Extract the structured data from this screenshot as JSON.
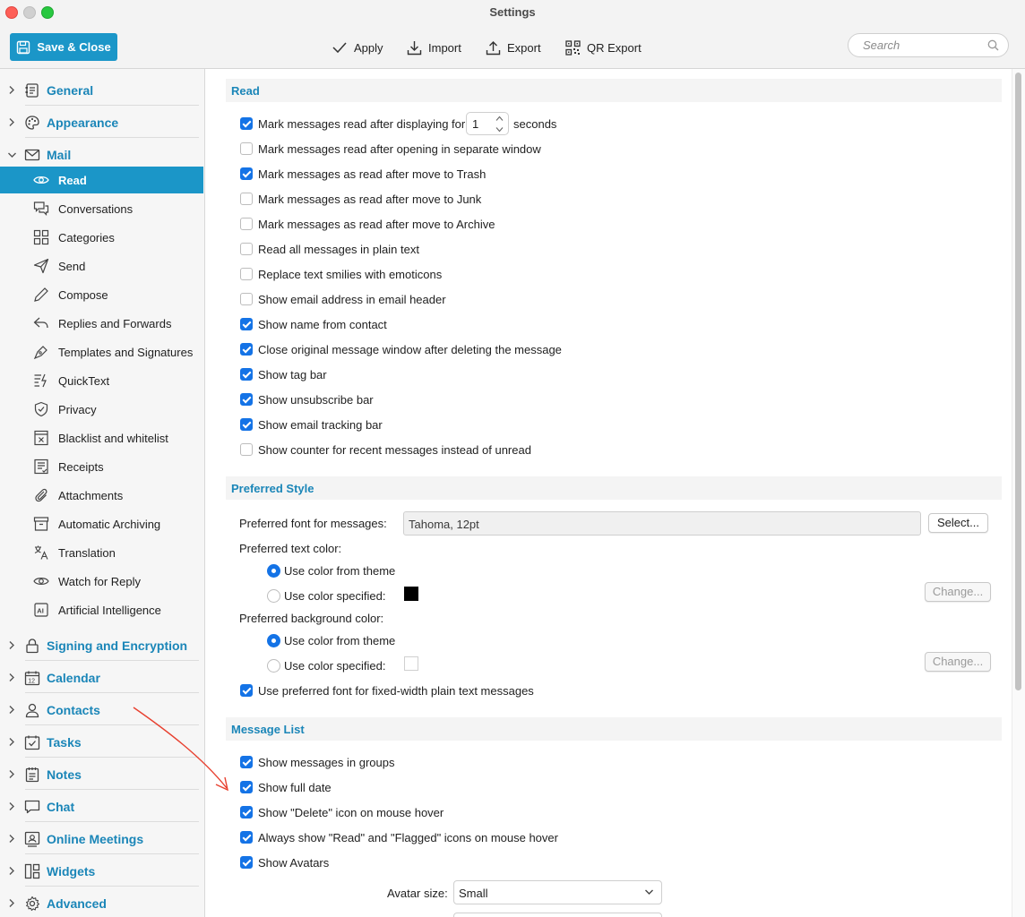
{
  "window": {
    "title": "Settings"
  },
  "toolbar": {
    "save_close": "Save & Close",
    "apply": "Apply",
    "import": "Import",
    "export": "Export",
    "qr_export": "QR Export",
    "search_placeholder": "Search"
  },
  "sidebar": {
    "groups_top": [
      {
        "label": "General",
        "icon": "document-icon"
      },
      {
        "label": "Appearance",
        "icon": "palette-icon"
      },
      {
        "label": "Mail",
        "icon": "envelope-icon",
        "expanded": true
      }
    ],
    "mail_items": [
      {
        "label": "Read",
        "icon": "eye-icon",
        "active": true
      },
      {
        "label": "Conversations",
        "icon": "chat-bubbles-icon"
      },
      {
        "label": "Categories",
        "icon": "grid-icon"
      },
      {
        "label": "Send",
        "icon": "paper-plane-icon"
      },
      {
        "label": "Compose",
        "icon": "pencil-icon"
      },
      {
        "label": "Replies and Forwards",
        "icon": "reply-icon"
      },
      {
        "label": "Templates and Signatures",
        "icon": "pen-nib-icon"
      },
      {
        "label": "QuickText",
        "icon": "quicktext-icon"
      },
      {
        "label": "Privacy",
        "icon": "shield-icon"
      },
      {
        "label": "Blacklist and whitelist",
        "icon": "block-box-icon"
      },
      {
        "label": "Receipts",
        "icon": "receipt-icon"
      },
      {
        "label": "Attachments",
        "icon": "paperclip-icon"
      },
      {
        "label": "Automatic Archiving",
        "icon": "archive-icon"
      },
      {
        "label": "Translation",
        "icon": "translate-icon"
      },
      {
        "label": "Watch for Reply",
        "icon": "eye-icon"
      },
      {
        "label": "Artificial Intelligence",
        "icon": "ai-icon"
      }
    ],
    "groups_bottom": [
      {
        "label": "Signing and Encryption",
        "icon": "lock-icon"
      },
      {
        "label": "Calendar",
        "icon": "calendar-icon"
      },
      {
        "label": "Contacts",
        "icon": "person-icon"
      },
      {
        "label": "Tasks",
        "icon": "task-check-icon"
      },
      {
        "label": "Notes",
        "icon": "notes-icon"
      },
      {
        "label": "Chat",
        "icon": "chat-icon"
      },
      {
        "label": "Online Meetings",
        "icon": "video-meeting-icon"
      },
      {
        "label": "Widgets",
        "icon": "widgets-icon"
      },
      {
        "label": "Advanced",
        "icon": "gear-icon"
      }
    ]
  },
  "read_section": {
    "title": "Read",
    "first": {
      "label_before": "Mark messages read after displaying for",
      "value": "1",
      "label_after": "seconds",
      "checked": true
    },
    "options": [
      {
        "label": "Mark messages read after opening in separate window",
        "checked": false
      },
      {
        "label": "Mark messages as read after move to Trash",
        "checked": true
      },
      {
        "label": "Mark messages as read after move to Junk",
        "checked": false
      },
      {
        "label": "Mark messages as read after move to Archive",
        "checked": false
      },
      {
        "label": "Read all messages in plain text",
        "checked": false
      },
      {
        "label": "Replace text smilies with emoticons",
        "checked": false
      },
      {
        "label": "Show email address in email header",
        "checked": false
      },
      {
        "label": "Show name from contact",
        "checked": true
      },
      {
        "label": "Close original message window after deleting the message",
        "checked": true
      },
      {
        "label": "Show tag bar",
        "checked": true
      },
      {
        "label": "Show unsubscribe bar",
        "checked": true
      },
      {
        "label": "Show email tracking bar",
        "checked": true
      },
      {
        "label": "Show counter for recent messages instead of unread",
        "checked": false
      }
    ]
  },
  "style_section": {
    "title": "Preferred Style",
    "font_label": "Preferred font for messages:",
    "font_value": "Tahoma, 12pt",
    "select_button": "Select...",
    "text_color_label": "Preferred text color:",
    "text_color_theme": "Use color from theme",
    "text_color_specified": "Use color specified:",
    "text_color_swatch": "#000000",
    "bg_color_label": "Preferred background color:",
    "bg_color_theme": "Use color from theme",
    "bg_color_specified": "Use color specified:",
    "bg_color_swatch": "#ffffff",
    "change_button": "Change...",
    "fixed_width": {
      "label": "Use preferred font for fixed-width plain text messages",
      "checked": true
    }
  },
  "message_list_section": {
    "title": "Message List",
    "options": [
      {
        "label": "Show messages in groups",
        "checked": true
      },
      {
        "label": "Show full date",
        "checked": true
      },
      {
        "label": "Show \"Delete\" icon on mouse hover",
        "checked": true
      },
      {
        "label": "Always show \"Read\" and \"Flagged\" icons on mouse hover",
        "checked": true
      },
      {
        "label": "Show Avatars",
        "checked": true
      }
    ],
    "avatar_size_label": "Avatar size:",
    "avatar_size_value": "Small"
  },
  "colors": {
    "accent": "#1b96c8",
    "checkbox": "#1473e6",
    "annotation": "#e8402f"
  }
}
